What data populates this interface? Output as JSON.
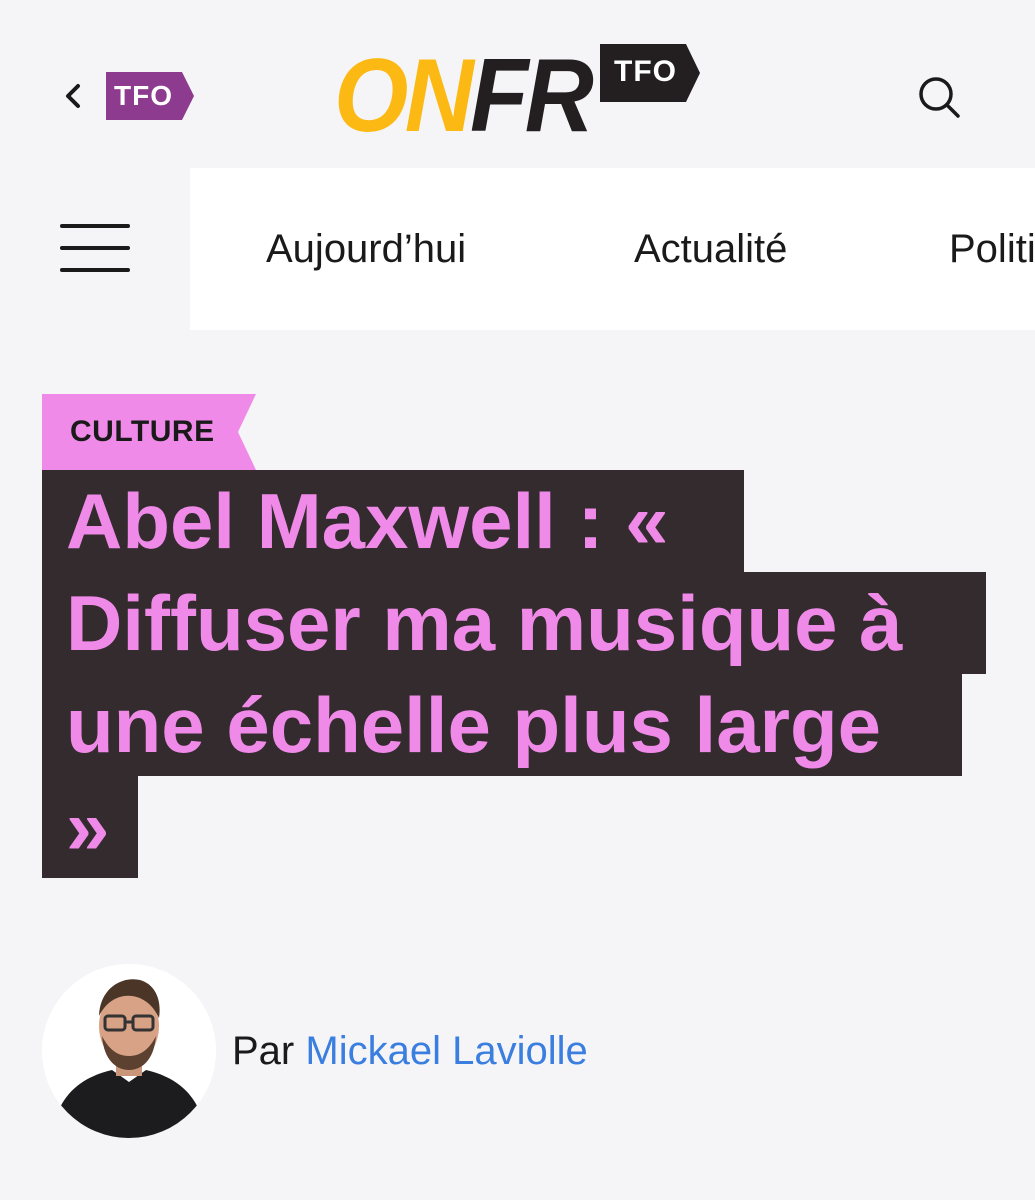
{
  "header": {
    "back_badge": "TFO",
    "logo": {
      "on": "ON",
      "fr": "FR",
      "tag": "TFO"
    }
  },
  "nav": {
    "items": [
      "Aujourd’hui",
      "Actualité",
      "Politique"
    ]
  },
  "article": {
    "category": "CULTURE",
    "headline_lines": [
      "Abel Maxwell : «",
      "Diffuser ma musique à",
      "une échelle plus large",
      "»"
    ],
    "byline_prefix": "Par",
    "author": "Mickael Laviolle"
  },
  "colors": {
    "background": "#f5f5f8",
    "logo_yellow": "#fcb913",
    "tfo_purple": "#8d3b8e",
    "category_pink": "#f08ae8",
    "headline_bg": "#332b2e",
    "headline_text": "#f08ae8",
    "author_link": "#3a7ee0"
  },
  "icons": {
    "back": "chevron-left-icon",
    "search": "search-icon",
    "menu": "hamburger-menu-icon"
  }
}
